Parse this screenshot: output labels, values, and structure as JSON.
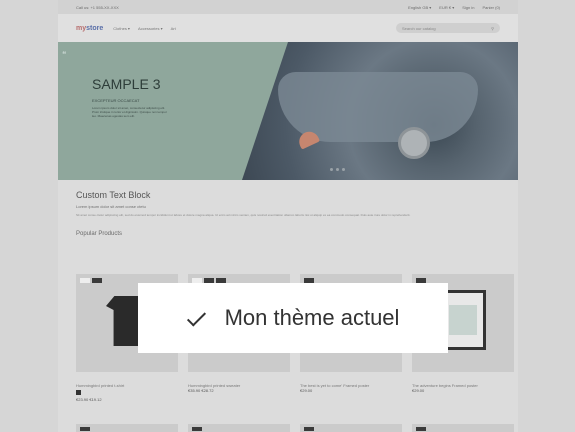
{
  "topbar": {
    "contact": "Call us: +1 555-XX-XXX",
    "language": "English GB ▾",
    "currency": "EUR € ▾",
    "signin": "Sign in",
    "cart": "Panier (0)"
  },
  "nav": {
    "logo_a": "my",
    "logo_b": "store",
    "menu": [
      "Clothes ▾",
      "Accessories ▾",
      "Art"
    ],
    "search_placeholder": "Search our catalog"
  },
  "hero": {
    "title": "SAMPLE 3",
    "subtitle": "EXCEPTEUR OCCAECAT",
    "text": "Lorem ipsum dolor sit amet, consectetur adipiscing elit. Proin tristique in tortor et dignissim. Quisque non tempor leo. Maecenas egestas sem elit."
  },
  "content": {
    "block_title": "Custom Text Block",
    "block_subtitle": "Lorem ipsum dolor sit amet conse ctetu",
    "block_text": "Sit amet conse ctetur adipiscing elit, sed do eiusmod tempor incididunt ut labore et dolore magna aliqua. Ut enim ad minim veniam, quis nostrud exercitation ullamco laboris nisi ut aliquip ex ea commodo consequat. Duis aute irure dolor in reprehenderit.",
    "popular": "Popular Products"
  },
  "products": [
    {
      "name": "Hummingbird printed t-shirt",
      "price": "€23.90 €19.12"
    },
    {
      "name": "Hummingbird printed sweater",
      "price": "€35.90 €28.72"
    },
    {
      "name": "The best is yet to come' Framed poster",
      "price": "€29.00"
    },
    {
      "name": "The adventure begins Framed poster",
      "price": "€29.00"
    }
  ],
  "overlay": {
    "label": "Mon thème actuel"
  }
}
